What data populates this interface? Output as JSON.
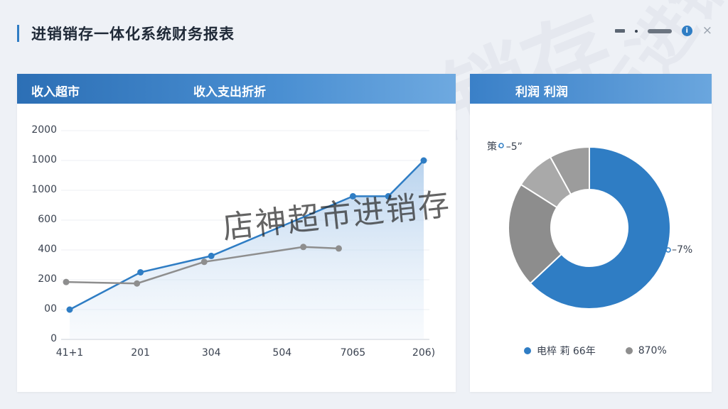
{
  "window": {
    "title": "进销销存一体化系统财务报表",
    "controls": [
      "minimize-icon",
      "dot-icon",
      "slider-icon",
      "info-icon",
      "close-icon"
    ],
    "close_glyph": "×",
    "info_glyph": "i"
  },
  "left_panel": {
    "header_left": "收入超市",
    "header_right": "收入支出折折"
  },
  "right_panel": {
    "header": "利润   利润"
  },
  "watermark": {
    "text": "店神超市进销存",
    "background_text": "店神超市进销存"
  },
  "colors": {
    "accent": "#2f7dc4",
    "series_blue": "#2f7dc4",
    "series_gray": "#8e8e8e",
    "donut_light": "#a9a9a9",
    "donut_mid": "#8d8d8d"
  },
  "chart_data": [
    {
      "type": "line",
      "title": "",
      "xlabel": "",
      "ylabel": "",
      "y_tick_labels": [
        "0",
        "00",
        "200",
        "400",
        "600",
        "1000",
        "1000",
        "2000"
      ],
      "x_tick_labels": [
        "41+1",
        "201",
        "304",
        "504",
        "7065",
        "206)"
      ],
      "ylim": [
        0,
        1400
      ],
      "grid": true,
      "series": [
        {
          "values_x": [
            0,
            1,
            2,
            4,
            4.5,
            5
          ],
          "values_y": [
            200,
            450,
            560,
            960,
            960,
            1200
          ],
          "fill": true
        },
        {
          "values_x": [
            -0.05,
            0.95,
            1.9,
            3.3,
            3.8
          ],
          "values_y": [
            385,
            375,
            520,
            620,
            610
          ]
        }
      ]
    },
    {
      "type": "pie",
      "style": "donut",
      "top_label": "策• –5ˮ",
      "right_label": "–7%",
      "slices": [
        {
          "value": 63,
          "color": "#2f7dc4"
        },
        {
          "value": 21,
          "color": "#8d8d8d"
        },
        {
          "value": 8,
          "color": "#a9a9a9"
        },
        {
          "value": 8,
          "color": "#9c9c9c"
        }
      ],
      "legend": [
        {
          "label": "电椊 莉 66年",
          "color": "#2f7dc4"
        },
        {
          "label": "870%",
          "color": "#8e8e8e"
        }
      ],
      "legend_position": "bottom"
    }
  ]
}
